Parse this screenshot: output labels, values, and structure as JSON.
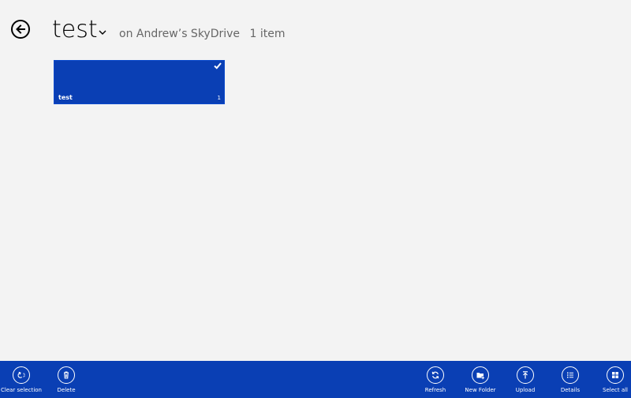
{
  "header": {
    "title": "test",
    "location": "on Andrew’s SkyDrive",
    "item_count": "1 item"
  },
  "tiles": [
    {
      "name": "test",
      "count": "1",
      "selected": true
    }
  ],
  "appbar": {
    "left": [
      {
        "label": "Clear selection",
        "icon": "clear-selection-icon"
      },
      {
        "label": "Delete",
        "icon": "trash-icon"
      }
    ],
    "right": [
      {
        "label": "Refresh",
        "icon": "refresh-icon"
      },
      {
        "label": "New Folder",
        "icon": "new-folder-icon"
      },
      {
        "label": "Upload",
        "icon": "upload-icon"
      },
      {
        "label": "Details",
        "icon": "details-icon"
      },
      {
        "label": "Select all",
        "icon": "select-all-icon"
      }
    ]
  },
  "colors": {
    "background": "#f3f3f3",
    "accent": "#0a3fb4",
    "subtitle_text": "#666666"
  }
}
